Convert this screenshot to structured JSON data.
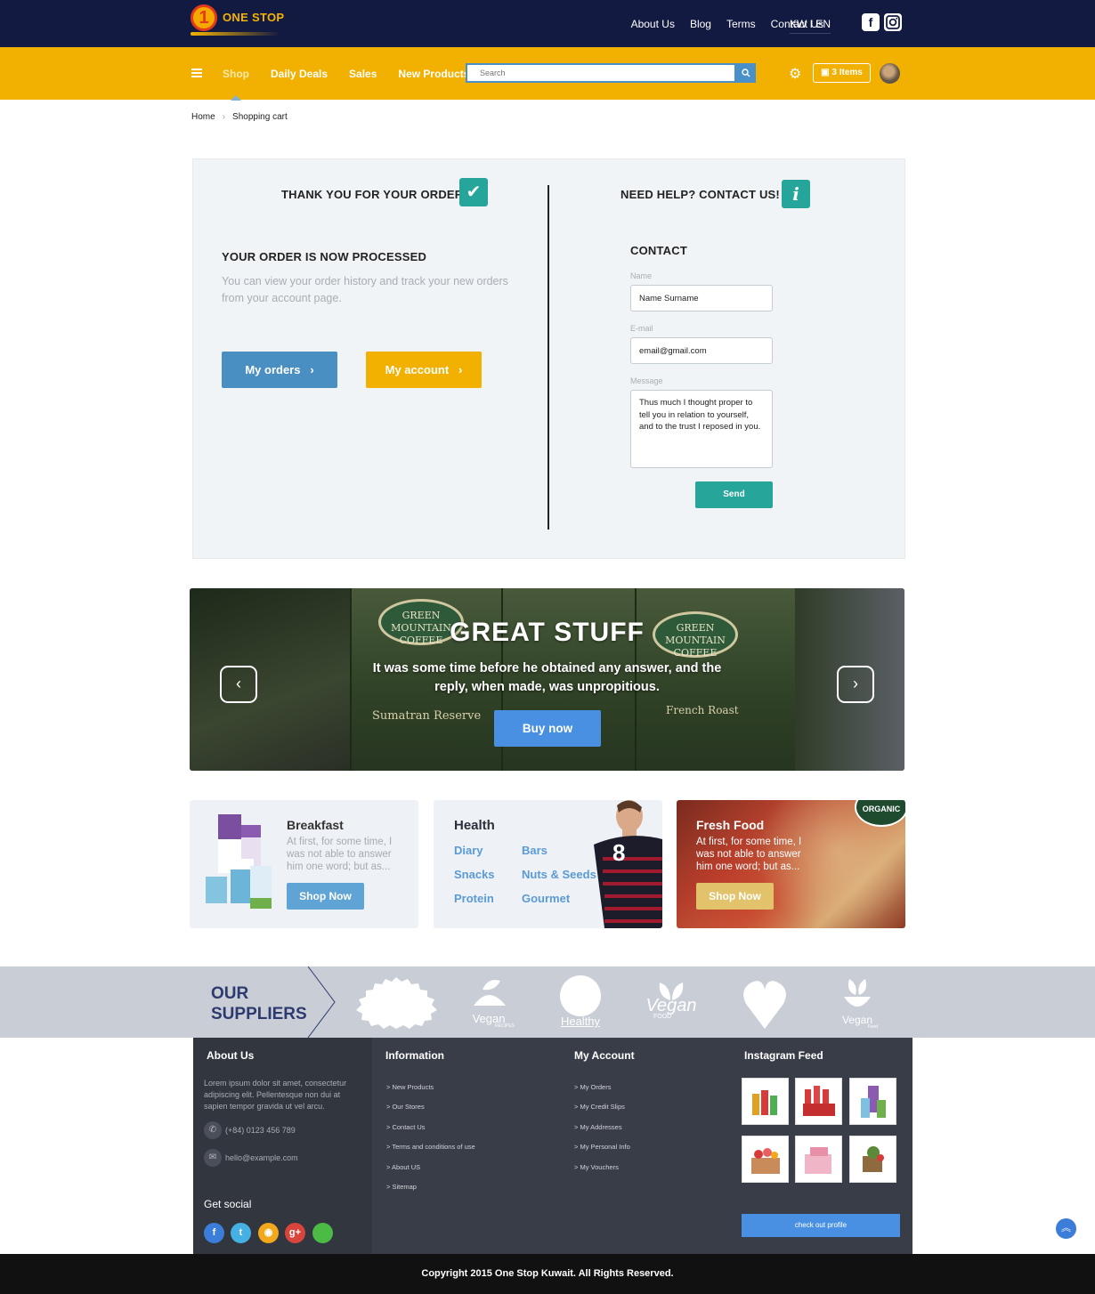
{
  "header": {
    "logo_number": "1",
    "logo_text": "ONE STOP",
    "links": [
      "About Us",
      "Blog",
      "Terms",
      "Contact Us"
    ],
    "language": "KW I EN",
    "social": [
      "facebook-icon",
      "instagram-icon"
    ]
  },
  "nav": {
    "items": [
      "Shop",
      "Daily Deals",
      "Sales",
      "New Products"
    ],
    "search_placeholder": "Search",
    "cart_label": "3 Items",
    "accent": "#f2b000"
  },
  "breadcrumb": [
    "Home",
    "Shopping cart"
  ],
  "order": {
    "title": "THANK YOU FOR YOUR ORDER",
    "subtitle": "YOUR ORDER IS NOW PROCESSED",
    "text": "You can view your order history and track your new orders from your account page.",
    "orders_button": "My orders",
    "account_button": "My account"
  },
  "help": {
    "title": "NEED HELP? CONTACT US!",
    "contact_heading": "CONTACT",
    "name_label": "Name",
    "name_value": "Name Surname",
    "email_label": "E-mail",
    "email_value": "email@gmail.com",
    "message_label": "Message",
    "message_value": "Thus much I thought proper to tell you in relation to yourself, and to the trust I reposed in you.",
    "send_button": "Send"
  },
  "banner": {
    "title": "GREAT STUFF",
    "text": "It was some time before he obtained any answer, and the reply, when made, was unpropitious.",
    "button": "Buy now",
    "bag_labels": [
      "GREEN MOUNTAIN COFFEE",
      "Sumatran Reserve",
      "French Roast"
    ]
  },
  "cards": {
    "breakfast": {
      "title": "Breakfast",
      "text": "At first, for some time, I was not able to answer him one word; but as...",
      "button": "Shop Now"
    },
    "health": {
      "title": "Health",
      "links": [
        "Diary",
        "Bars",
        "Snacks",
        "Nuts & Seeds",
        "Protein",
        "Gourmet"
      ],
      "jersey_number": "8"
    },
    "fresh": {
      "title": "Fresh Food",
      "text": "At first, for some time, I was not able to answer him one word; but as...",
      "button": "Shop Now",
      "badge": "ORGANIC"
    }
  },
  "suppliers": {
    "title_line1": "OUR",
    "title_line2": "SUPPLIERS",
    "logos": [
      "Vegan",
      "Healthy",
      "Vegan",
      "Vegan"
    ],
    "logo_subs": [
      "RECIPES",
      "FOOD",
      "Food"
    ]
  },
  "footer": {
    "about_title": "About Us",
    "about_text": "Lorem ipsum dolor sit amet, consectetur adipiscing elit. Pellentesque non dui at sapien tempor gravida ut vel arcu.",
    "phone": "(+84) 0123 456 789",
    "email": "hello@example.com",
    "social_title": "Get social",
    "info_title": "Information",
    "info_links": [
      "> New Products",
      "> Our Stores",
      "> Contact Us",
      "> Terms and conditions of use",
      "> About US",
      "> Sitemap"
    ],
    "account_title": "My Account",
    "account_links": [
      "> My Orders",
      "> My Credit Slips",
      "> My Addresses",
      "> My Personal Info",
      "> My Vouchers"
    ],
    "instagram_title": "Instagram Feed",
    "checkout_button": "check out profile",
    "copyright": "Copyright 2015 One Stop Kuwait. All Rights Reserved."
  }
}
